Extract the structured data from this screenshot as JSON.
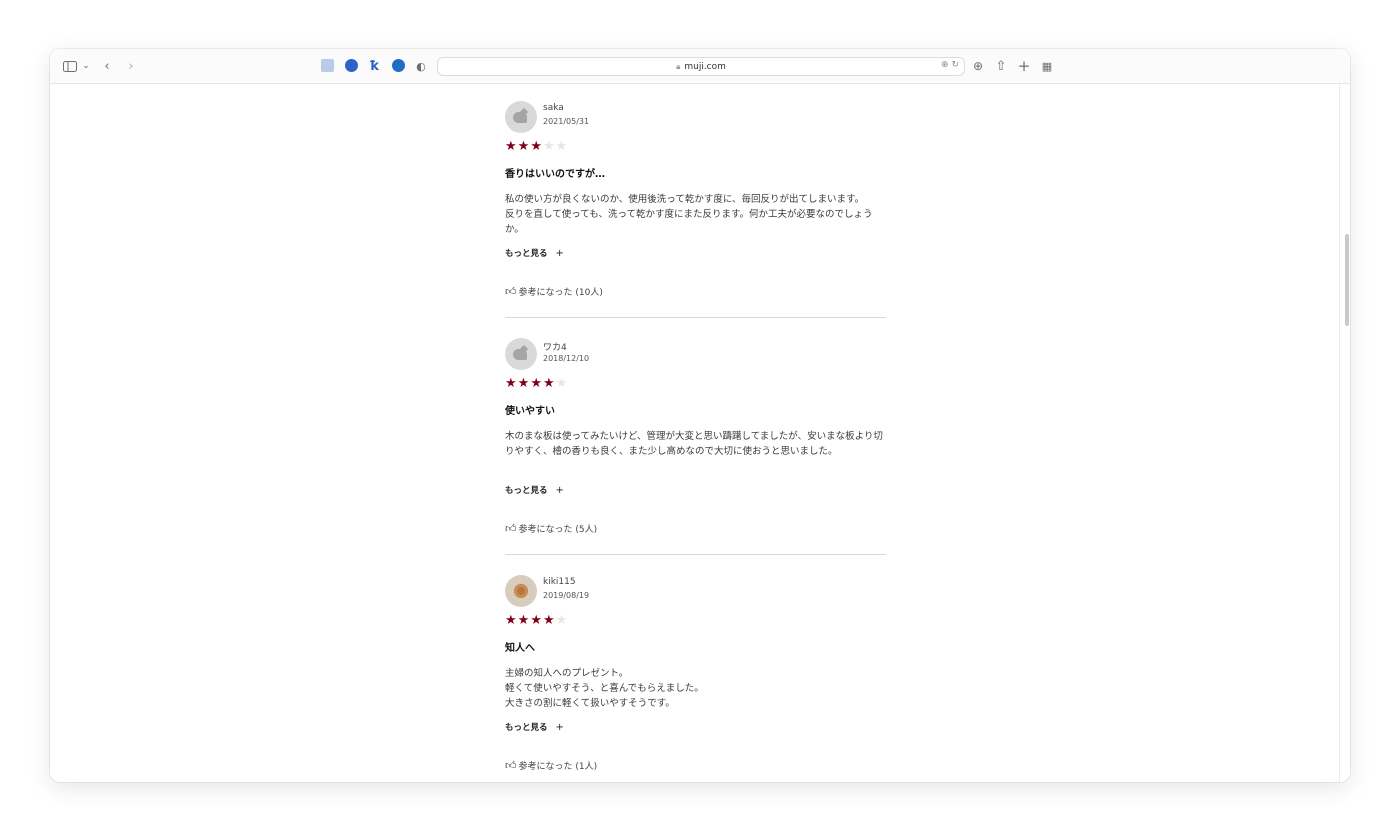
{
  "browser": {
    "url": "muji.com"
  },
  "reviews": [
    {
      "name": "saka",
      "date": "2021/05/31",
      "rating": 3,
      "title": "香りはいいのですが…",
      "body": "私の使い方が良くないのか、使用後洗って乾かす度に、毎回反りが出てしまいます。\n反りを直して使っても、洗って乾かす度にまた反ります。何か工夫が必要なのでしょうか。",
      "more_label": "もっと見る",
      "helpful": "参考になった (10人)"
    },
    {
      "name": "ワカ4",
      "date": "2018/12/10",
      "rating": 4,
      "title": "使いやすい",
      "body": "木のまな板は使ってみたいけど、管理が大変と思い躊躇してましたが、安いまな板より切りやすく、檜の香りも良く、また少し高めなので大切に使おうと思いました。",
      "more_label": "もっと見る",
      "helpful": "参考になった (5人)"
    },
    {
      "name": "kiki115",
      "date": "2019/08/19",
      "rating": 4,
      "title": "知人へ",
      "body": "主婦の知人へのプレゼント。\n軽くて使いやすそう、と喜んでもらえました。\n大きさの割に軽くて扱いやすそうです。",
      "more_label": "もっと見る",
      "helpful": "参考になった (1人)"
    }
  ],
  "colors": {
    "star_on": "#7f0019",
    "star_off": "#e6e6e6"
  }
}
